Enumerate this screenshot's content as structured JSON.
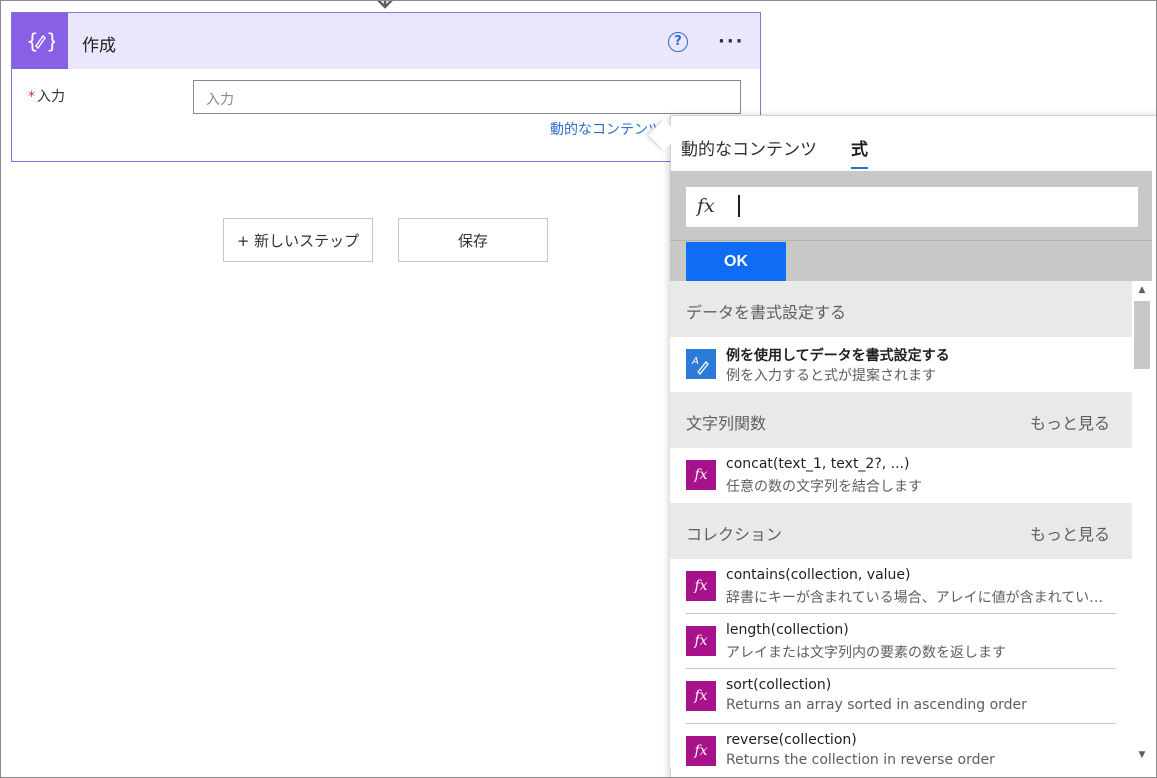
{
  "card": {
    "title": "作成",
    "help": "?",
    "more": "···",
    "field_label": "入力",
    "field_required": "*",
    "field_placeholder": "入力",
    "dynamic_link": "動的なコンテンツ"
  },
  "buttons": {
    "new_step": "+ 新しいステップ",
    "save": "保存"
  },
  "flyout": {
    "tabs": [
      "動的なコンテンツ",
      "式"
    ],
    "active_tab": "式",
    "fx": "fx",
    "ok": "OK",
    "sections": [
      {
        "title": "データを書式設定する",
        "more": "",
        "items": [
          {
            "name": "例を使用してデータを書式設定する",
            "desc": "例を入力すると式が提案されます"
          }
        ]
      },
      {
        "title": "文字列関数",
        "more": "もっと見る",
        "items": [
          {
            "name": "concat(text_1, text_2?, ...)",
            "desc": "任意の数の文字列を結合します"
          }
        ]
      },
      {
        "title": "コレクション",
        "more": "もっと見る",
        "items": [
          {
            "name": "contains(collection, value)",
            "desc": "辞書にキーが含まれている場合、アレイに値が含まれている場合、文字列に部分文字列が含まれている場合に true を返します"
          },
          {
            "name": "length(collection)",
            "desc": "アレイまたは文字列内の要素の数を返します"
          },
          {
            "name": "sort(collection)",
            "desc": "Returns an array sorted in ascending order"
          },
          {
            "name": "reverse(collection)",
            "desc": "Returns the collection in reverse order"
          }
        ]
      }
    ]
  },
  "colors": {
    "accent_purple": "#8860e6",
    "header_bg": "#ebe6fb",
    "link_blue": "#2b6fd1",
    "ok_blue": "#0f6cf5",
    "fx_magenta": "#a7118a"
  }
}
